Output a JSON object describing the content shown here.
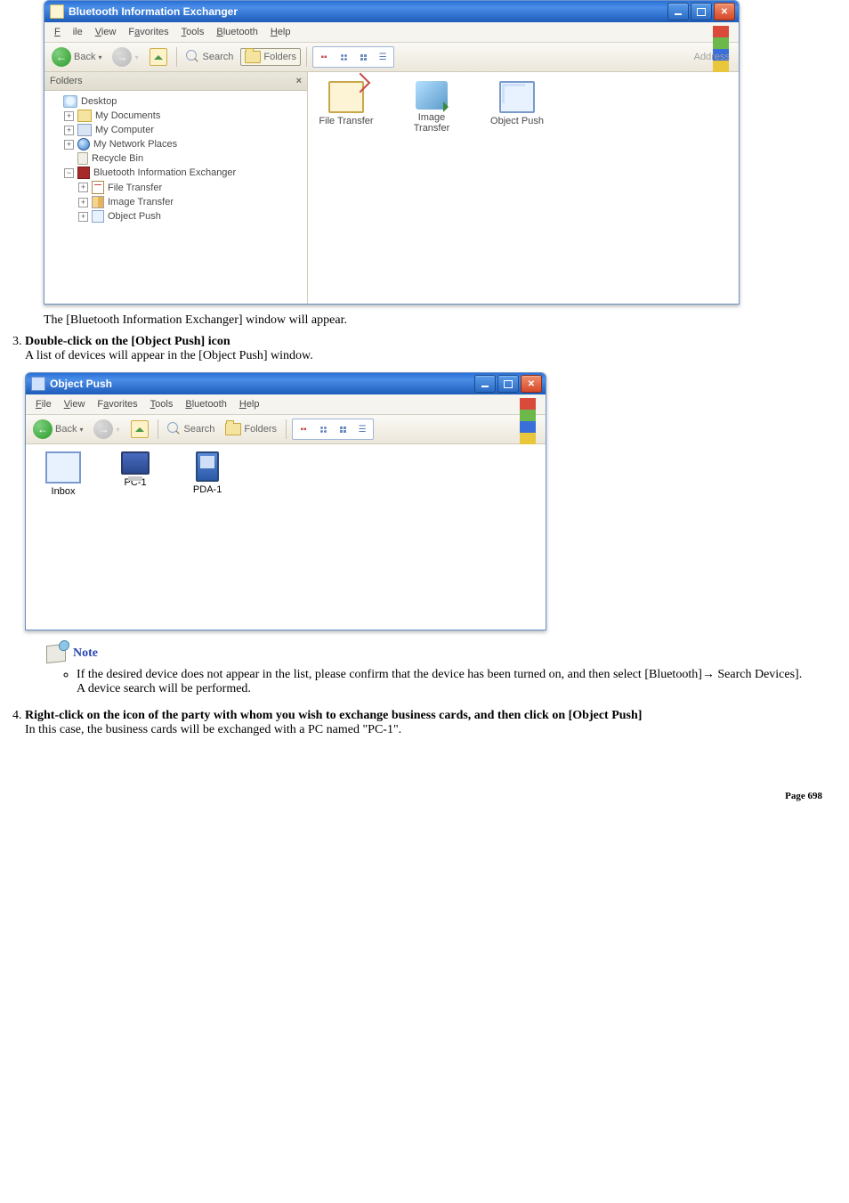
{
  "window1": {
    "title": "Bluetooth Information Exchanger",
    "menu": {
      "file": "File",
      "view": "View",
      "favorites": "Favorites",
      "tools": "Tools",
      "bluetooth": "Bluetooth",
      "help": "Help"
    },
    "toolbar": {
      "back": "Back",
      "search": "Search",
      "folders": "Folders",
      "address": "Address"
    },
    "pane_header": "Folders",
    "pane_close": "×",
    "tree": {
      "desktop": "Desktop",
      "mydocs": "My Documents",
      "mycomp": "My Computer",
      "netplaces": "My Network Places",
      "recycle": "Recycle Bin",
      "btexch": "Bluetooth Information Exchanger",
      "filetrans": "File Transfer",
      "imgtrans": "Image Transfer",
      "objpush": "Object Push"
    },
    "items": {
      "filetransfer": "File Transfer",
      "imagetransfer": "Image Transfer",
      "objectpush": "Object Push"
    }
  },
  "caption1": "The [Bluetooth Information Exchanger] window will appear.",
  "step3": {
    "head": "Double-click on the [Object Push] icon",
    "body": "A list of devices will appear in the [Object Push] window."
  },
  "window2": {
    "title": "Object Push",
    "menu": {
      "file": "File",
      "view": "View",
      "favorites": "Favorites",
      "tools": "Tools",
      "bluetooth": "Bluetooth",
      "help": "Help"
    },
    "toolbar": {
      "back": "Back",
      "search": "Search",
      "folders": "Folders"
    },
    "items": {
      "inbox": "Inbox",
      "pc1": "PC-1",
      "pda1": "PDA-1"
    }
  },
  "note_label": "Note",
  "note_line1": "If the desired device does not appear in the list, please confirm that the device has been turned on, and then select [Bluetooth]→ Search Devices].",
  "note_line2": "A device search will be performed.",
  "step4": {
    "head": "Right-click on the icon of the party with whom you wish to exchange business cards, and then click on [Object Push]",
    "body": "In this case, the business cards will be exchanged with a PC named \"PC-1\"."
  },
  "footer": {
    "label": "Page",
    "num": "698"
  }
}
